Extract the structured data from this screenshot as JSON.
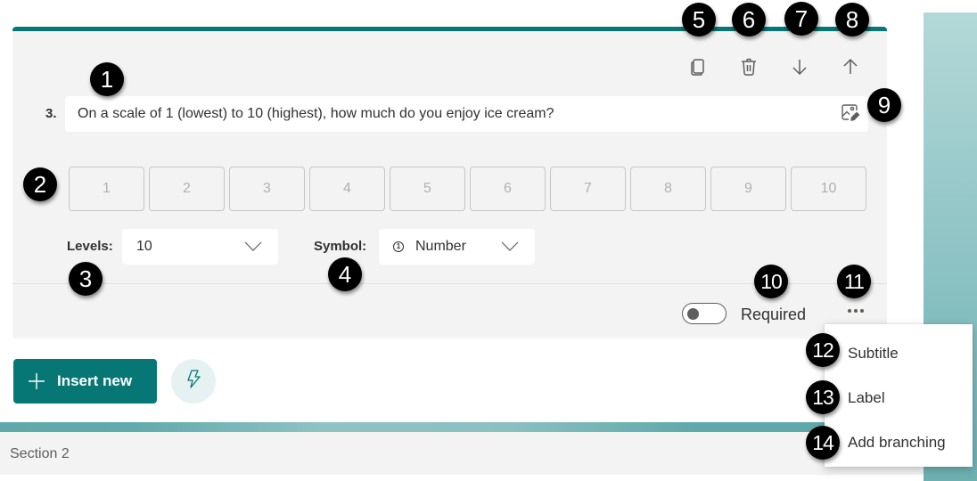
{
  "question": {
    "number": "3.",
    "text": "On a scale of 1 (lowest) to 10 (highest), how much do you enjoy ice cream?",
    "scale_options": [
      "1",
      "2",
      "3",
      "4",
      "5",
      "6",
      "7",
      "8",
      "9",
      "10"
    ]
  },
  "toolbar": {
    "copy_icon": "copy-icon",
    "delete_icon": "trash-icon",
    "move_down_icon": "arrow-down-icon",
    "move_up_icon": "arrow-up-icon",
    "image_edit_icon": "image-edit-icon"
  },
  "settings": {
    "levels_label": "Levels:",
    "levels_value": "10",
    "symbol_label": "Symbol:",
    "symbol_icon_glyph": "1",
    "symbol_value": "Number"
  },
  "footer": {
    "required_label": "Required",
    "required_on": false,
    "more_icon": "more-options-icon"
  },
  "actions": {
    "insert_new_label": "Insert new",
    "quick_icon": "lightning-icon"
  },
  "section": {
    "title": "Section 2"
  },
  "menu": {
    "items": [
      {
        "label": "Subtitle"
      },
      {
        "label": "Label"
      },
      {
        "label": "Add branching"
      }
    ]
  },
  "badges": [
    "1",
    "2",
    "3",
    "4",
    "5",
    "6",
    "7",
    "8",
    "9",
    "10",
    "11",
    "12",
    "13",
    "14"
  ],
  "colors": {
    "accent": "#077776",
    "card_bg": "#f3f3f3",
    "text": "#323130",
    "muted": "#605e5c"
  }
}
